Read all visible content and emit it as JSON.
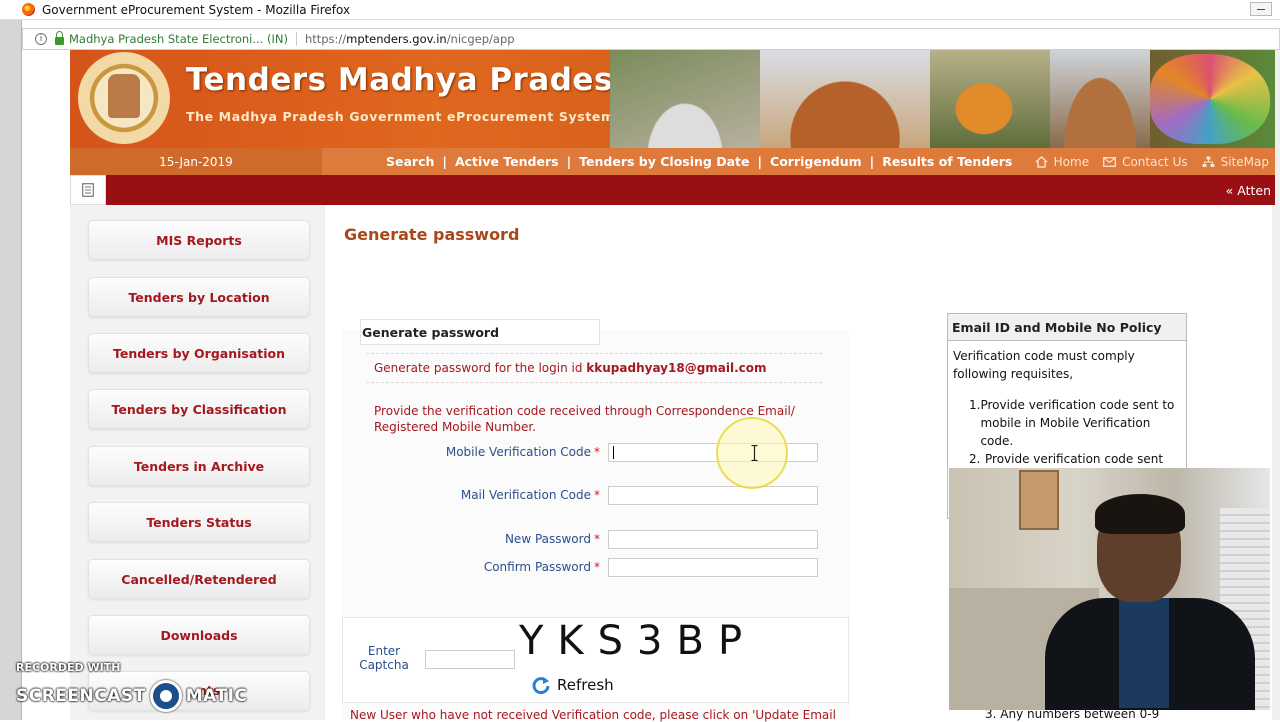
{
  "browser": {
    "window_title": "Government eProcurement System - Mozilla Firefox",
    "site_identity": "Madhya Pradesh State Electroni... (IN)",
    "url_prefix": "https://",
    "url_host": "mptenders.gov.in",
    "url_path": "/nicgep/app"
  },
  "banner": {
    "title": "Tenders Madhya Pradesh",
    "subtitle": "The Madhya Pradesh Government eProcurement System"
  },
  "nav": {
    "date": "15-Jan-2019",
    "links": [
      "Search",
      "Active Tenders",
      "Tenders by Closing Date",
      "Corrigendum",
      "Results of Tenders"
    ],
    "separator": "|",
    "right": {
      "home": "Home",
      "contact": "Contact Us",
      "sitemap": "SiteMap"
    }
  },
  "ticker": {
    "text": "« Atten"
  },
  "sidebar": {
    "items": [
      "MIS Reports",
      "Tenders by Location",
      "Tenders by Organisation",
      "Tenders by Classification",
      "Tenders in Archive",
      "Tenders Status",
      "Cancelled/Retendered",
      "Downloads"
    ],
    "partial_item": "nts"
  },
  "main": {
    "page_title": "Generate password",
    "tab_label": "Generate password",
    "login_text": "Generate password for the login id",
    "login_id": "kkupadhyay18@gmail.com",
    "instruction_line1": "Provide the verification code received through Correspondence Email/",
    "instruction_line2": "Registered Mobile Number.",
    "fields": {
      "mobile_code": "Mobile Verification Code",
      "mail_code": "Mail Verification Code",
      "new_password": "New Password",
      "confirm_password": "Confirm Password",
      "required_mark": "*"
    },
    "captcha": {
      "label_line1": "Enter",
      "label_line2": "Captcha",
      "code": "YKS3BP",
      "refresh": "Refresh"
    },
    "bottom_note": "New User who have not received Verification code, please click on 'Update Email"
  },
  "policy": {
    "heading": "Email ID and Mobile No Policy",
    "intro": "Verification code must comply following requisites,",
    "items": [
      "Provide verification code sent to mobile in Mobile Verification code.",
      "Provide verification code sent"
    ],
    "item_numbers": [
      "1.",
      "2."
    ],
    "partial_item": "3. Any numbers between 0-9"
  },
  "watermark": {
    "small": "RECORDED WITH",
    "left": "SCREENCAST",
    "right": "MATIC"
  },
  "colors": {
    "banner_orange": "#d4541a",
    "nav_orange": "#de7a3b",
    "ticker_red": "#9a0f14",
    "link_red": "#a4191f",
    "label_blue": "#2a4f8a"
  }
}
